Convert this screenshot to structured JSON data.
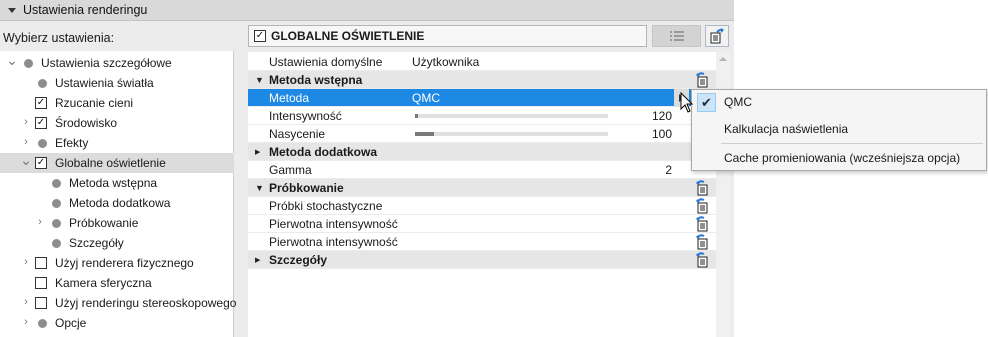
{
  "window": {
    "title": "Ustawienia renderingu"
  },
  "left": {
    "label": "Wybierz ustawienia:",
    "tree": [
      {
        "label": "Ustawienia szczegółowe",
        "level": 0,
        "expander": "expanded",
        "marker": "dot"
      },
      {
        "label": "Ustawienia światła",
        "level": 1,
        "expander": "none",
        "marker": "dot"
      },
      {
        "label": "Rzucanie cieni",
        "level": 1,
        "expander": "none",
        "marker": "checkbox",
        "checked": true
      },
      {
        "label": "Środowisko",
        "level": 1,
        "expander": "collapsed",
        "marker": "checkbox",
        "checked": true
      },
      {
        "label": "Efekty",
        "level": 1,
        "expander": "collapsed",
        "marker": "dot"
      },
      {
        "label": "Globalne oświetlenie",
        "level": 1,
        "expander": "expanded",
        "marker": "checkbox",
        "checked": true,
        "selected": true
      },
      {
        "label": "Metoda wstępna",
        "level": 2,
        "expander": "none",
        "marker": "dot"
      },
      {
        "label": "Metoda dodatkowa",
        "level": 2,
        "expander": "none",
        "marker": "dot"
      },
      {
        "label": "Próbkowanie",
        "level": 2,
        "expander": "collapsed",
        "marker": "dot"
      },
      {
        "label": "Szczegóły",
        "level": 2,
        "expander": "none",
        "marker": "dot"
      },
      {
        "label": "Użyj renderera fizycznego",
        "level": 1,
        "expander": "collapsed",
        "marker": "checkbox",
        "checked": false
      },
      {
        "label": "Kamera sferyczna",
        "level": 1,
        "expander": "none",
        "marker": "checkbox",
        "checked": false
      },
      {
        "label": "Użyj renderingu stereoskopowego",
        "level": 1,
        "expander": "collapsed",
        "marker": "checkbox",
        "checked": false
      },
      {
        "label": "Opcje",
        "level": 1,
        "expander": "collapsed",
        "marker": "dot"
      }
    ]
  },
  "right": {
    "header": {
      "title": "GLOBALNE OŚWIETLENIE",
      "checked": true
    },
    "rows": [
      {
        "kind": "prop",
        "key": "Ustawienia domyślne",
        "value": "Użytkownika"
      },
      {
        "kind": "section",
        "key": "Metoda wstępna",
        "expanded": true,
        "icon": true
      },
      {
        "kind": "prop",
        "key": "Metoda",
        "value": "QMC",
        "highlight": true,
        "dropdown": true
      },
      {
        "kind": "slider",
        "key": "Intensywność",
        "number": "120",
        "fraction": 0.005
      },
      {
        "kind": "slider",
        "key": "Nasycenie",
        "number": "100",
        "fraction": 0.1
      },
      {
        "kind": "section",
        "key": "Metoda dodatkowa",
        "expanded": false
      },
      {
        "kind": "number",
        "key": "Gamma",
        "number": "2"
      },
      {
        "kind": "section",
        "key": "Próbkowanie",
        "expanded": true,
        "icon": true
      },
      {
        "kind": "prop",
        "key": "Próbki stochastyczne",
        "icon": true
      },
      {
        "kind": "prop",
        "key": "Pierwotna intensywność",
        "icon": true
      },
      {
        "kind": "prop",
        "key": "Pierwotna intensywność",
        "icon": true
      },
      {
        "kind": "section",
        "key": "Szczegóły",
        "expanded": false,
        "icon": true
      }
    ]
  },
  "menu": {
    "items": [
      {
        "label": "QMC",
        "checked": true
      },
      {
        "label": "Kalkulacja naświetlenia",
        "checked": false
      },
      {
        "label": "Cache promieniowania (wcześniejsza opcja)",
        "checked": false
      }
    ]
  },
  "colors": {
    "selection": "#1e88e5",
    "icon_blue": "#2a7ad5"
  }
}
